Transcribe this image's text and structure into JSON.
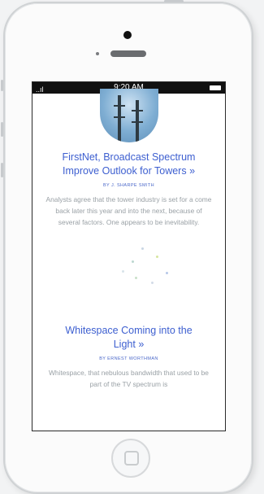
{
  "statusbar": {
    "signal": "..ıl",
    "time": "9:20 AM"
  },
  "articles": [
    {
      "headline": "FirstNet, Broadcast Spectrum Improve Outlook for Towers »",
      "byline": "BY J. SHARPE SMITH",
      "summary": "Analysts agree that the tower industry is set for a come back later this year and into the next, because of several factors. One appears to be inevitability."
    },
    {
      "headline": "Whitespace Coming into the Light »",
      "byline": "BY ERNEST WORTHMAN",
      "summary": "Whitespace, that nebulous bandwidth that used to be part of the TV spectrum is"
    }
  ],
  "colors": {
    "link": "#3d5fd0",
    "body_text": "#9aa1a6",
    "phone_frame": "#cfd2d4"
  }
}
